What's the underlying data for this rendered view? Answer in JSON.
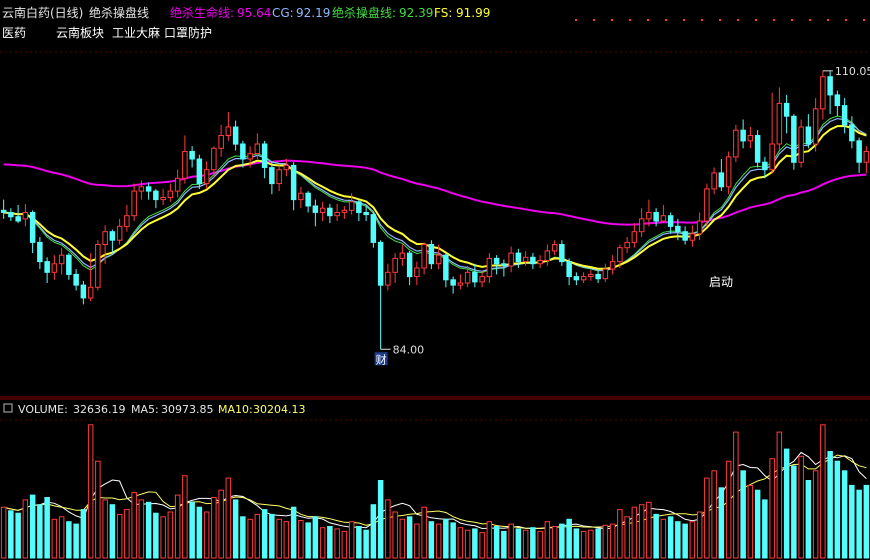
{
  "header": {
    "stock_label": "云南白药(日线)",
    "indicator_name": "绝杀操盘线",
    "life_line_label": "绝杀生命线:",
    "life_line_value": "95.64",
    "cg_label": "CG:",
    "cg_value": "92.19",
    "op_line_label": "绝杀操盘线:",
    "op_line_value": "92.39",
    "fs_label": "FS:",
    "fs_value": "91.99",
    "tags": [
      "医药",
      "云南板块",
      "工业大麻",
      "口罩防护"
    ]
  },
  "volume_header": {
    "volume_label": "VOLUME:",
    "volume_value": "32636.19",
    "ma5_label": "MA5:",
    "ma5_value": "30973.85",
    "ma10_label": "MA10:",
    "ma10_value": "30204.13"
  },
  "annotations": {
    "high_label": "110.05",
    "low_label": "84.00",
    "cai_marker": "财",
    "qidong_label": "启动"
  },
  "colors": {
    "up": "#ff3b3b",
    "down": "#54fcfc",
    "life_line": "#ee00ee",
    "cg": "#8fb8ff",
    "op_line": "#44dd44",
    "fs": "#ffff33",
    "text": "#ffffff",
    "grid": "#8b0000"
  },
  "chart_data": {
    "type": "candlestick",
    "price_ylim": [
      80,
      112
    ],
    "candles": [
      [
        97.0,
        96.8,
        98.0,
        96.2
      ],
      [
        96.8,
        96.4,
        97.2,
        96.0
      ],
      [
        96.4,
        96.0,
        97.5,
        95.8
      ],
      [
        96.2,
        96.8,
        97.6,
        95.5
      ],
      [
        96.8,
        94.0,
        97.0,
        93.0
      ],
      [
        94.0,
        92.2,
        94.5,
        91.5
      ],
      [
        92.2,
        91.2,
        92.6,
        90.2
      ],
      [
        91.2,
        92.0,
        92.8,
        90.5
      ],
      [
        92.0,
        92.8,
        93.5,
        91.0
      ],
      [
        92.8,
        91.0,
        93.0,
        90.5
      ],
      [
        91.0,
        90.0,
        91.5,
        89.5
      ],
      [
        90.0,
        88.8,
        90.4,
        88.2
      ],
      [
        88.8,
        89.8,
        93.0,
        88.5
      ],
      [
        89.8,
        93.8,
        94.2,
        89.5
      ],
      [
        93.8,
        95.0,
        95.6,
        92.0
      ],
      [
        95.0,
        94.2,
        95.2,
        93.0
      ],
      [
        94.2,
        95.5,
        96.2,
        93.8
      ],
      [
        95.5,
        96.5,
        97.5,
        95.0
      ],
      [
        96.5,
        98.8,
        99.5,
        96.0
      ],
      [
        98.8,
        99.2,
        99.8,
        98.0
      ],
      [
        99.2,
        98.8,
        99.6,
        98.0
      ],
      [
        98.8,
        98.0,
        99.0,
        97.2
      ],
      [
        98.0,
        98.2,
        99.0,
        97.5
      ],
      [
        98.2,
        98.8,
        99.5,
        97.8
      ],
      [
        98.8,
        100.0,
        100.8,
        98.2
      ],
      [
        100.0,
        102.5,
        104.0,
        99.5
      ],
      [
        102.5,
        101.8,
        103.0,
        101.0
      ],
      [
        101.8,
        99.5,
        102.2,
        99.0
      ],
      [
        99.5,
        100.8,
        101.6,
        99.0
      ],
      [
        100.8,
        102.8,
        103.0,
        100.0
      ],
      [
        102.8,
        104.0,
        105.0,
        102.0
      ],
      [
        104.0,
        104.8,
        106.2,
        103.5
      ],
      [
        104.8,
        103.2,
        105.4,
        102.6
      ],
      [
        103.2,
        101.8,
        103.5,
        101.0
      ],
      [
        101.8,
        102.3,
        103.0,
        101.0
      ],
      [
        102.3,
        103.2,
        104.2,
        101.8
      ],
      [
        103.2,
        101.0,
        103.5,
        100.0
      ],
      [
        101.0,
        99.5,
        101.5,
        98.5
      ],
      [
        99.5,
        100.8,
        101.2,
        98.8
      ],
      [
        100.8,
        101.2,
        101.8,
        100.2
      ],
      [
        101.2,
        98.0,
        101.5,
        97.0
      ],
      [
        98.0,
        98.6,
        99.2,
        97.2
      ],
      [
        98.6,
        97.4,
        98.8,
        96.8
      ],
      [
        97.4,
        96.8,
        98.0,
        95.5
      ],
      [
        96.8,
        97.2,
        97.8,
        96.0
      ],
      [
        97.2,
        96.5,
        97.6,
        95.8
      ],
      [
        96.5,
        96.8,
        97.6,
        96.0
      ],
      [
        96.8,
        97.0,
        97.4,
        96.2
      ],
      [
        97.0,
        97.8,
        98.6,
        96.6
      ],
      [
        97.8,
        96.8,
        98.0,
        96.0
      ],
      [
        96.8,
        96.6,
        97.4,
        96.0
      ],
      [
        96.6,
        94.0,
        96.8,
        93.5
      ],
      [
        94.0,
        90.0,
        94.2,
        84.0
      ],
      [
        90.0,
        91.2,
        92.0,
        89.5
      ],
      [
        91.2,
        92.5,
        93.0,
        90.2
      ],
      [
        92.5,
        93.0,
        93.8,
        91.8
      ],
      [
        93.0,
        90.8,
        93.2,
        90.0
      ],
      [
        90.8,
        91.6,
        92.2,
        90.0
      ],
      [
        91.6,
        93.8,
        94.0,
        91.0
      ],
      [
        93.8,
        92.0,
        94.2,
        91.5
      ],
      [
        92.0,
        92.8,
        93.8,
        91.5
      ],
      [
        92.8,
        90.5,
        93.0,
        89.8
      ],
      [
        90.5,
        90.0,
        90.8,
        89.2
      ],
      [
        90.0,
        90.2,
        91.0,
        89.6
      ],
      [
        90.2,
        91.2,
        91.8,
        89.8
      ],
      [
        91.2,
        90.3,
        92.0,
        89.8
      ],
      [
        90.3,
        90.8,
        91.3,
        89.8
      ],
      [
        90.8,
        92.5,
        93.0,
        90.2
      ],
      [
        92.5,
        92.0,
        92.8,
        91.0
      ],
      [
        92.0,
        91.8,
        92.4,
        90.8
      ],
      [
        91.8,
        93.0,
        93.6,
        91.2
      ],
      [
        93.0,
        92.2,
        93.4,
        91.6
      ],
      [
        92.2,
        92.6,
        93.2,
        91.8
      ],
      [
        92.6,
        92.0,
        93.0,
        91.5
      ],
      [
        92.0,
        92.3,
        92.8,
        91.6
      ],
      [
        92.3,
        93.2,
        93.8,
        91.8
      ],
      [
        93.2,
        93.8,
        94.2,
        92.8
      ],
      [
        93.8,
        92.2,
        94.2,
        91.8
      ],
      [
        92.2,
        90.8,
        92.5,
        90.0
      ],
      [
        90.8,
        90.5,
        91.2,
        90.0
      ],
      [
        90.5,
        90.8,
        91.2,
        90.2
      ],
      [
        90.8,
        91.0,
        91.4,
        90.4
      ],
      [
        91.0,
        90.6,
        91.3,
        90.2
      ],
      [
        90.6,
        91.5,
        92.0,
        90.3
      ],
      [
        91.5,
        92.2,
        92.8,
        91.0
      ],
      [
        92.2,
        93.5,
        93.8,
        91.6
      ],
      [
        93.5,
        94.0,
        94.5,
        93.0
      ],
      [
        94.0,
        95.0,
        95.8,
        93.5
      ],
      [
        95.0,
        96.2,
        97.2,
        94.5
      ],
      [
        96.2,
        96.8,
        98.0,
        95.5
      ],
      [
        96.8,
        96.0,
        97.2,
        95.5
      ],
      [
        96.0,
        96.5,
        97.5,
        95.8
      ],
      [
        96.5,
        95.5,
        96.8,
        94.8
      ],
      [
        95.5,
        95.0,
        96.2,
        94.2
      ],
      [
        95.0,
        94.2,
        95.5,
        93.8
      ],
      [
        94.2,
        94.8,
        95.6,
        93.6
      ],
      [
        94.8,
        96.0,
        96.8,
        94.2
      ],
      [
        96.0,
        99.0,
        99.5,
        95.5
      ],
      [
        99.0,
        100.5,
        101.0,
        98.5
      ],
      [
        100.5,
        99.2,
        101.8,
        98.8
      ],
      [
        99.2,
        102.0,
        102.5,
        98.5
      ],
      [
        102.0,
        104.5,
        105.0,
        101.5
      ],
      [
        104.5,
        103.5,
        105.5,
        102.8
      ],
      [
        103.5,
        104.0,
        104.8,
        102.8
      ],
      [
        104.0,
        101.5,
        104.5,
        101.0
      ],
      [
        101.5,
        100.8,
        102.0,
        100.0
      ],
      [
        100.8,
        103.2,
        108.0,
        100.5
      ],
      [
        103.2,
        107.0,
        108.5,
        102.5
      ],
      [
        107.0,
        105.8,
        107.8,
        104.2
      ],
      [
        105.8,
        101.5,
        106.0,
        100.8
      ],
      [
        101.5,
        104.8,
        105.5,
        101.0
      ],
      [
        104.8,
        103.2,
        106.0,
        102.8
      ],
      [
        103.2,
        106.5,
        107.5,
        102.5
      ],
      [
        106.5,
        109.5,
        110.05,
        105.5
      ],
      [
        109.5,
        107.8,
        110.0,
        106.0
      ],
      [
        107.8,
        106.8,
        108.2,
        105.8
      ],
      [
        106.8,
        105.0,
        107.5,
        104.2
      ],
      [
        105.0,
        103.5,
        105.8,
        102.8
      ],
      [
        103.5,
        101.5,
        103.8,
        100.5
      ],
      [
        101.5,
        102.5,
        103.0,
        100.5
      ]
    ],
    "volume": [
      [
        21000,
        "u"
      ],
      [
        19500,
        "d"
      ],
      [
        18500,
        "d"
      ],
      [
        24000,
        "u"
      ],
      [
        26000,
        "d"
      ],
      [
        22000,
        "d"
      ],
      [
        25000,
        "d"
      ],
      [
        16000,
        "u"
      ],
      [
        17000,
        "u"
      ],
      [
        15000,
        "d"
      ],
      [
        14000,
        "d"
      ],
      [
        20000,
        "d"
      ],
      [
        55000,
        "u"
      ],
      [
        40000,
        "u"
      ],
      [
        24000,
        "u"
      ],
      [
        22000,
        "d"
      ],
      [
        18000,
        "u"
      ],
      [
        20000,
        "u"
      ],
      [
        27000,
        "u"
      ],
      [
        24000,
        "u"
      ],
      [
        23000,
        "d"
      ],
      [
        18500,
        "d"
      ],
      [
        17000,
        "u"
      ],
      [
        19000,
        "u"
      ],
      [
        26000,
        "u"
      ],
      [
        34000,
        "u"
      ],
      [
        23000,
        "d"
      ],
      [
        21000,
        "d"
      ],
      [
        19000,
        "u"
      ],
      [
        25000,
        "u"
      ],
      [
        28000,
        "u"
      ],
      [
        33000,
        "u"
      ],
      [
        24000,
        "d"
      ],
      [
        17000,
        "d"
      ],
      [
        16000,
        "u"
      ],
      [
        18000,
        "u"
      ],
      [
        20000,
        "d"
      ],
      [
        18000,
        "d"
      ],
      [
        16000,
        "u"
      ],
      [
        15000,
        "u"
      ],
      [
        21000,
        "d"
      ],
      [
        15500,
        "u"
      ],
      [
        14500,
        "d"
      ],
      [
        17000,
        "d"
      ],
      [
        12500,
        "u"
      ],
      [
        13000,
        "d"
      ],
      [
        12000,
        "u"
      ],
      [
        11000,
        "u"
      ],
      [
        15000,
        "u"
      ],
      [
        13000,
        "d"
      ],
      [
        11500,
        "d"
      ],
      [
        22000,
        "d"
      ],
      [
        32000,
        "d"
      ],
      [
        24000,
        "u"
      ],
      [
        19000,
        "u"
      ],
      [
        16000,
        "u"
      ],
      [
        17000,
        "d"
      ],
      [
        14000,
        "u"
      ],
      [
        21000,
        "u"
      ],
      [
        15000,
        "d"
      ],
      [
        14000,
        "u"
      ],
      [
        16000,
        "d"
      ],
      [
        14500,
        "d"
      ],
      [
        12500,
        "u"
      ],
      [
        11500,
        "u"
      ],
      [
        12000,
        "d"
      ],
      [
        10500,
        "u"
      ],
      [
        15000,
        "u"
      ],
      [
        13000,
        "d"
      ],
      [
        11000,
        "d"
      ],
      [
        14000,
        "u"
      ],
      [
        12000,
        "d"
      ],
      [
        11500,
        "u"
      ],
      [
        12500,
        "d"
      ],
      [
        11000,
        "u"
      ],
      [
        15000,
        "u"
      ],
      [
        13000,
        "u"
      ],
      [
        14000,
        "d"
      ],
      [
        16000,
        "d"
      ],
      [
        12000,
        "d"
      ],
      [
        11000,
        "u"
      ],
      [
        11500,
        "u"
      ],
      [
        12000,
        "d"
      ],
      [
        13500,
        "u"
      ],
      [
        14000,
        "u"
      ],
      [
        20000,
        "u"
      ],
      [
        17000,
        "u"
      ],
      [
        21000,
        "u"
      ],
      [
        22000,
        "u"
      ],
      [
        23000,
        "u"
      ],
      [
        18000,
        "d"
      ],
      [
        16000,
        "u"
      ],
      [
        17000,
        "d"
      ],
      [
        15000,
        "d"
      ],
      [
        14000,
        "d"
      ],
      [
        15000,
        "u"
      ],
      [
        19000,
        "u"
      ],
      [
        33000,
        "u"
      ],
      [
        36000,
        "u"
      ],
      [
        29000,
        "d"
      ],
      [
        40000,
        "u"
      ],
      [
        52000,
        "u"
      ],
      [
        36000,
        "d"
      ],
      [
        30000,
        "u"
      ],
      [
        28000,
        "d"
      ],
      [
        24000,
        "d"
      ],
      [
        41000,
        "u"
      ],
      [
        52000,
        "u"
      ],
      [
        45000,
        "d"
      ],
      [
        38000,
        "d"
      ],
      [
        42000,
        "u"
      ],
      [
        32000,
        "d"
      ],
      [
        36000,
        "u"
      ],
      [
        55000,
        "u"
      ],
      [
        44000,
        "d"
      ],
      [
        40000,
        "d"
      ],
      [
        36000,
        "d"
      ],
      [
        30000,
        "d"
      ],
      [
        28000,
        "d"
      ],
      [
        30000,
        "d"
      ]
    ]
  }
}
